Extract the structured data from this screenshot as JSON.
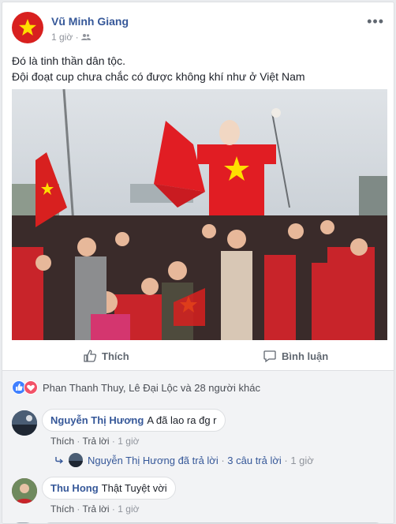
{
  "post": {
    "author": "Vũ Minh Giang",
    "time": "1 giờ",
    "menu_glyph": "•••",
    "line1": "Đó là tinh thần dân tộc.",
    "line2": "Đội đoạt cup chưa chắc có được không khí như ở Việt Nam",
    "audience_icon": "friends-icon"
  },
  "actions": {
    "like": "Thích",
    "comment": "Bình luận"
  },
  "reactions": {
    "text": "Phan Thanh Thuy, Lê Đại Lộc và 28 người khác"
  },
  "comments": [
    {
      "name": "Nguyễn Thị Hương",
      "text": "A đã lao ra đg r",
      "like": "Thích",
      "reply": "Trả lời",
      "time": "1 giờ",
      "reply_summary": {
        "name": "Nguyễn Thị Hương",
        "verb": "đã trả lời",
        "count": "3 câu trả lời",
        "time": "1 giờ"
      }
    },
    {
      "name": "Thu Hong",
      "text": "Thật Tuyệt vời",
      "like": "Thích",
      "reply": "Trả lời",
      "time": "1 giờ"
    }
  ],
  "colors": {
    "link": "#365899",
    "flag_red": "#d8201f",
    "star": "#ffde00",
    "like_blue": "#4080ff"
  }
}
